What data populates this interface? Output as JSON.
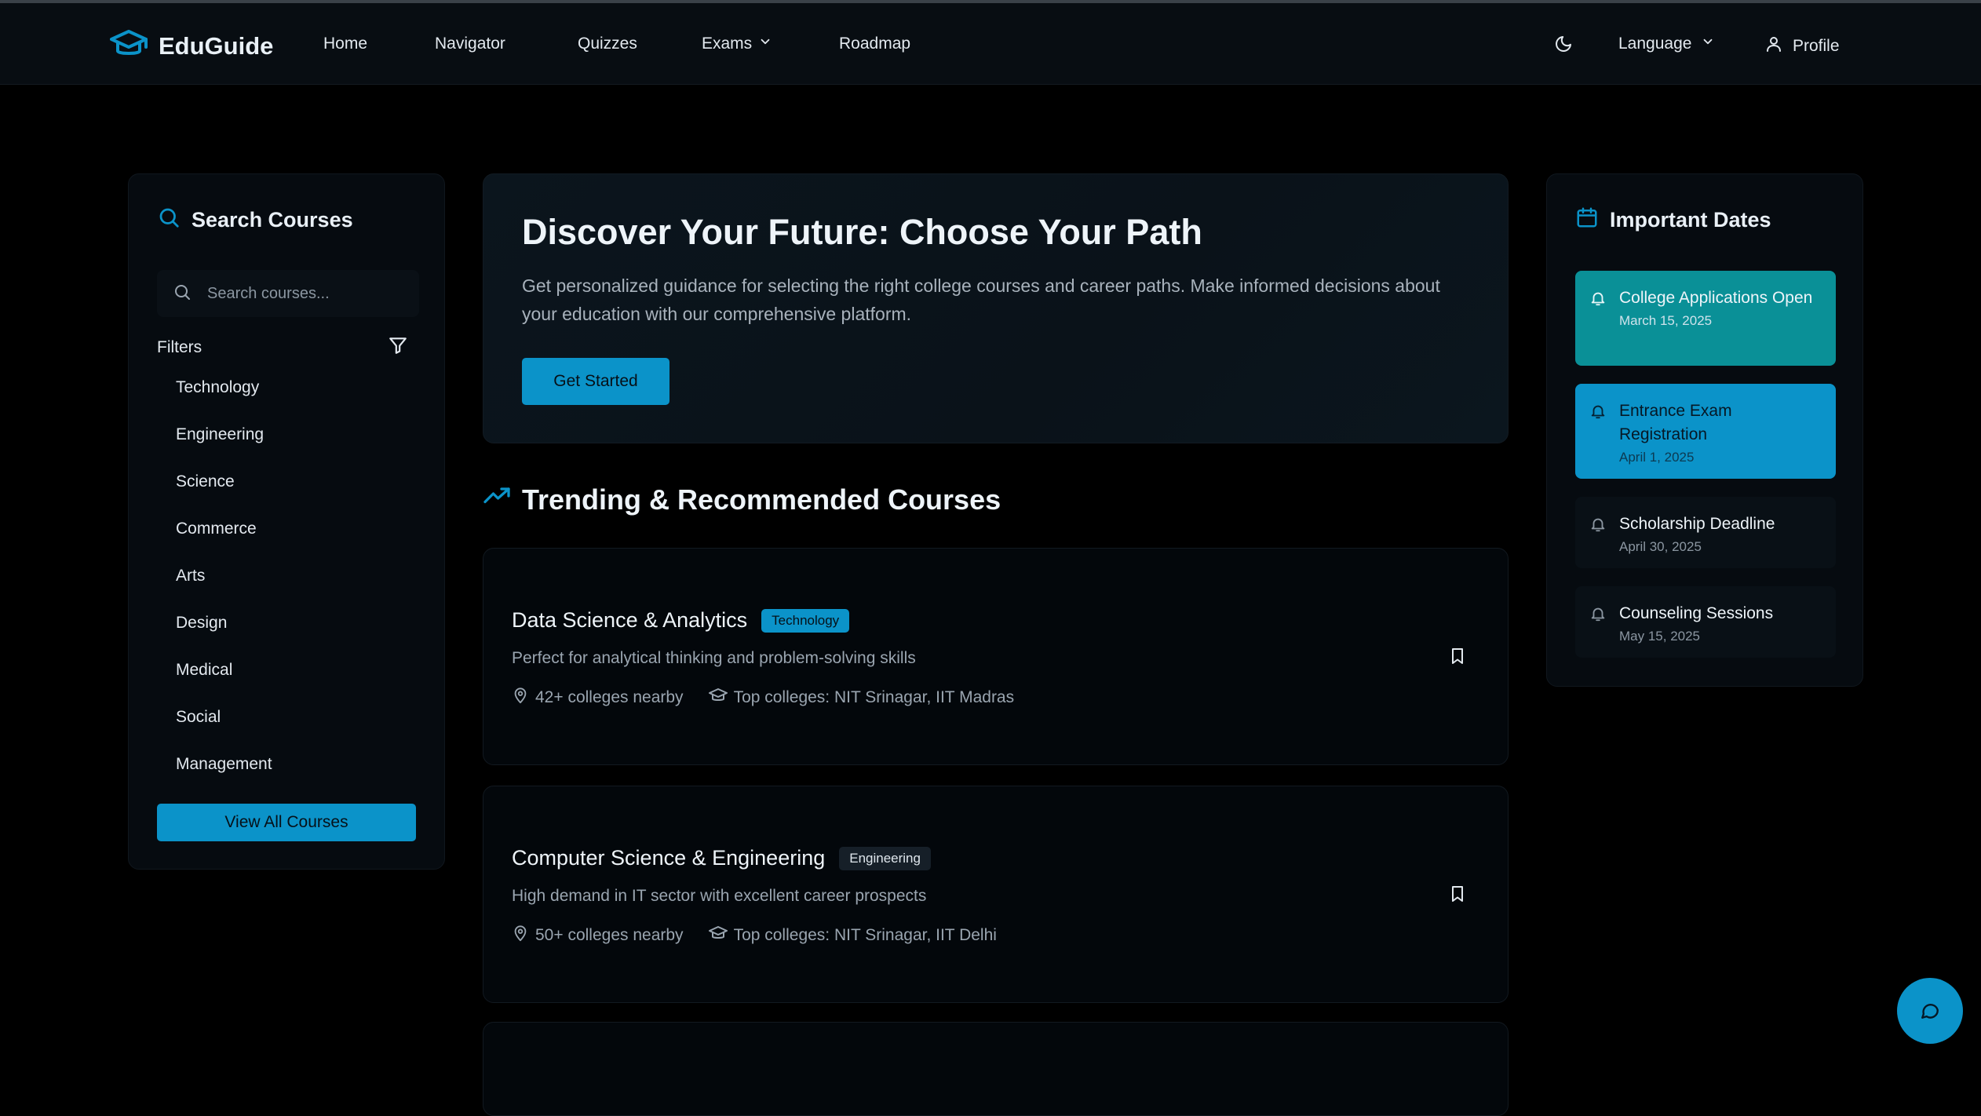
{
  "brand": {
    "name": "EduGuide"
  },
  "nav": {
    "home": "Home",
    "navigator": "Navigator",
    "quizzes": "Quizzes",
    "exams": "Exams",
    "roadmap": "Roadmap",
    "language": "Language",
    "profile": "Profile"
  },
  "sidebar": {
    "title": "Search Courses",
    "search_placeholder": "Search courses...",
    "filters_label": "Filters",
    "filters": [
      "Technology",
      "Engineering",
      "Science",
      "Commerce",
      "Arts",
      "Design",
      "Medical",
      "Social",
      "Management"
    ],
    "view_all": "View All Courses"
  },
  "hero": {
    "title": "Discover Your Future: Choose Your Path",
    "description": "Get personalized guidance for selecting the right college courses and career paths. Make informed decisions about your education with our comprehensive platform.",
    "cta": "Get Started"
  },
  "trending": {
    "title": "Trending & Recommended Courses",
    "courses": [
      {
        "title": "Data Science & Analytics",
        "badge": "Technology",
        "description": "Perfect for analytical thinking and problem-solving skills",
        "colleges_nearby": "42+ colleges nearby",
        "top_colleges": "Top colleges: NIT Srinagar, IIT Madras"
      },
      {
        "title": "Computer Science & Engineering",
        "badge": "Engineering",
        "description": "High demand in IT sector with excellent career prospects",
        "colleges_nearby": "50+ colleges nearby",
        "top_colleges": "Top colleges: NIT Srinagar, IIT Delhi"
      }
    ]
  },
  "dates": {
    "title": "Important Dates",
    "items": [
      {
        "title": "College Applications Open",
        "date": "March 15, 2025"
      },
      {
        "title": "Entrance Exam Registration",
        "date": "April 1, 2025"
      },
      {
        "title": "Scholarship Deadline",
        "date": "April 30, 2025"
      },
      {
        "title": "Counseling Sessions",
        "date": "May 15, 2025"
      }
    ]
  },
  "colors": {
    "accent": "#0b93c9",
    "teal": "#0a9097",
    "background": "#000000",
    "panel": "#060b10"
  },
  "icons": {
    "logo": "graduation-cap-icon",
    "theme": "moon-icon",
    "profile": "user-icon",
    "search": "search-icon",
    "filter": "filter-icon",
    "trending": "trending-up-icon",
    "location": "map-pin-icon",
    "colleges": "graduation-cap-icon",
    "bookmark": "bookmark-icon",
    "calendar": "calendar-icon",
    "bell": "bell-icon",
    "chat": "chat-bubble-icon"
  }
}
